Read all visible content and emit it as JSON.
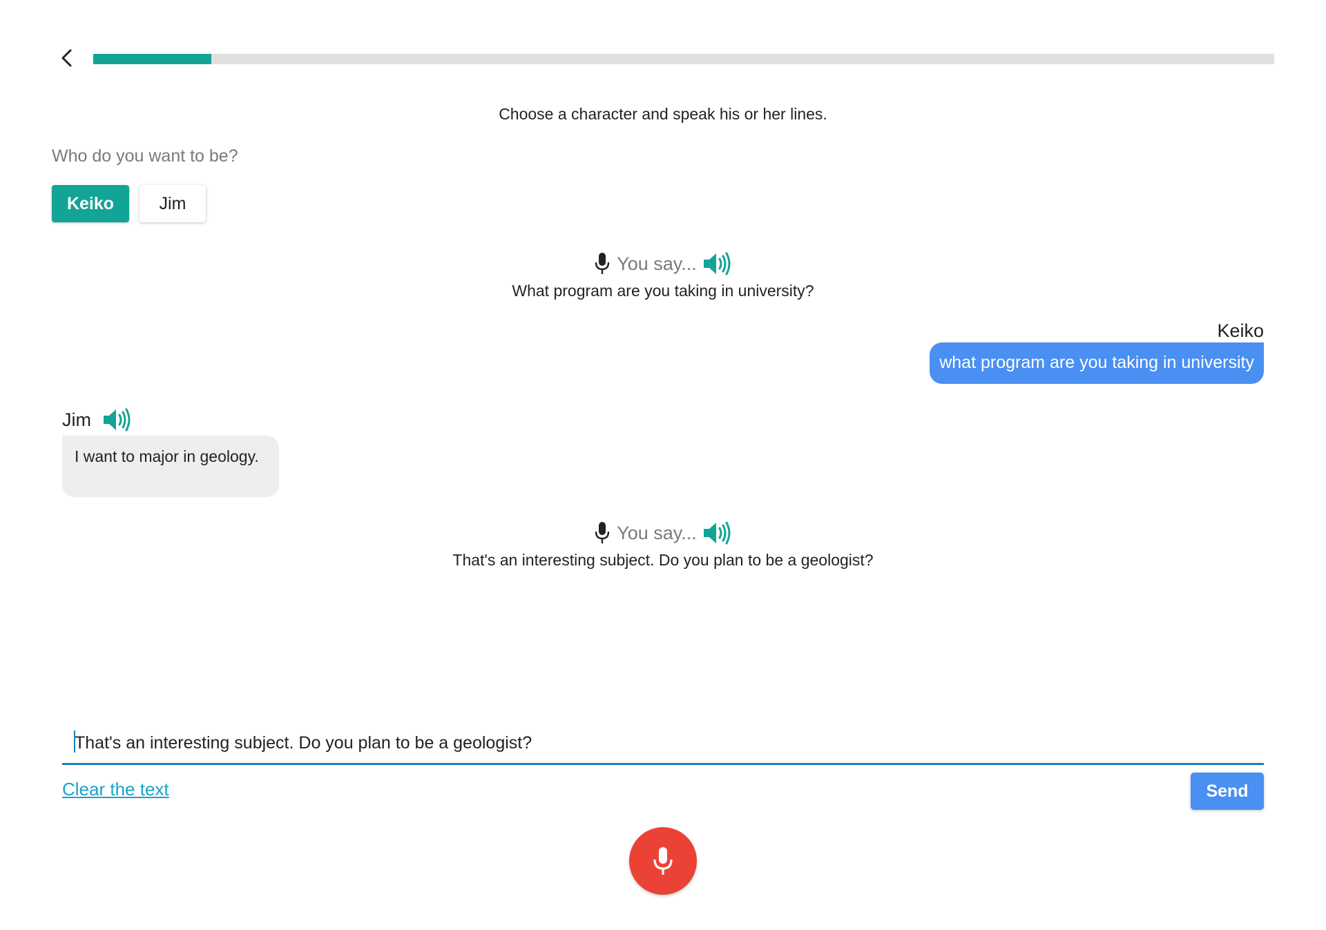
{
  "header": {
    "back_icon": "chevron-left-icon",
    "progress_fraction": 0.1
  },
  "instruction": "Choose a character and speak his or her lines.",
  "character_select": {
    "label": "Who do you want to be?",
    "options": [
      {
        "label": "Keiko",
        "selected": true
      },
      {
        "label": "Jim",
        "selected": false
      }
    ]
  },
  "conversation": {
    "prompt_1": {
      "head": "You say...",
      "line": "What program are you taking in university?"
    },
    "user_message": {
      "speaker": "Keiko",
      "text": "what program are you taking in university"
    },
    "partner_message": {
      "speaker": "Jim",
      "text": "I want to major in geology."
    },
    "prompt_2": {
      "head": "You say...",
      "line": "That's an interesting subject. Do you plan to be a geologist?"
    }
  },
  "input": {
    "value": "That's an interesting subject. Do you plan to be a geologist?",
    "clear_label": "Clear the text",
    "send_label": "Send"
  },
  "colors": {
    "accent": "#12a496",
    "bubble_blue": "#4a8ff2",
    "record_red": "#ea4335",
    "link": "#1aa3c8"
  },
  "icons": {
    "mic": "microphone-icon",
    "speaker": "speaker-icon",
    "record": "microphone-icon"
  }
}
